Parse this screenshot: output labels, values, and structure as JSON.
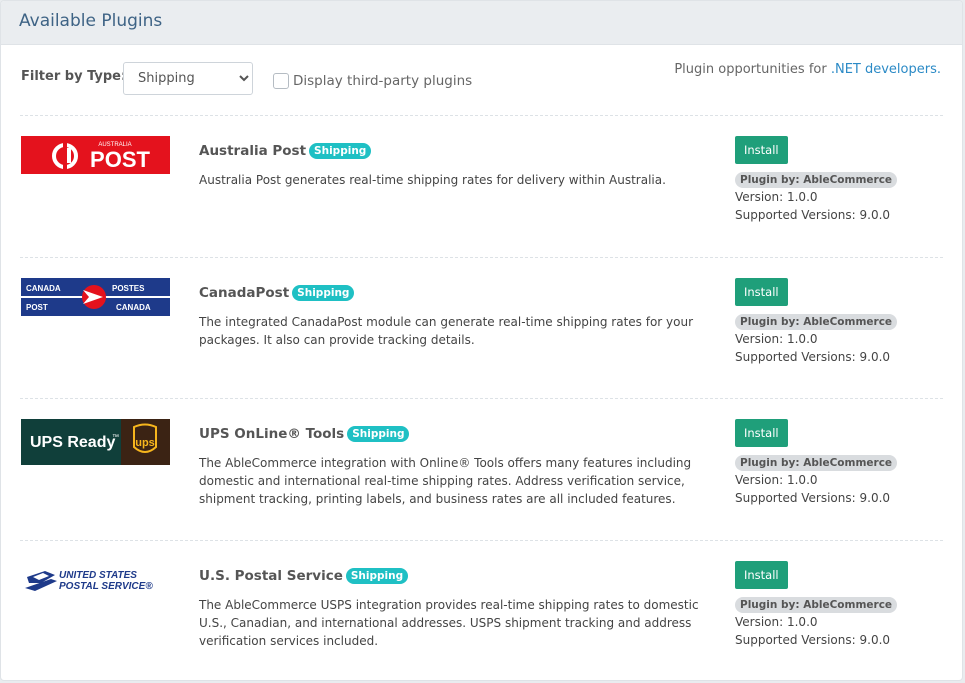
{
  "header": {
    "title": "Available Plugins"
  },
  "filter": {
    "label": "Filter by Type:",
    "selected": "Shipping",
    "third_party_label": "Display third-party plugins",
    "opportunities_prefix": "Plugin opportunities for ",
    "opportunities_link": ".NET developers."
  },
  "plugins": [
    {
      "name": "Australia Post",
      "type": "Shipping",
      "description": "Australia Post generates real-time shipping rates for delivery within Australia.",
      "install_label": "Install",
      "author": "Plugin by: AbleCommerce",
      "version": "Version: 1.0.0",
      "supported": "Supported Versions: 9.0.0",
      "logo_text": "POST",
      "logo_small": "AUSTRALIA"
    },
    {
      "name": "CanadaPost",
      "type": "Shipping",
      "description": "The integrated CanadaPost module can generate real-time shipping rates for your packages. It also can provide tracking details.",
      "install_label": "Install",
      "author": "Plugin by: AbleCommerce",
      "version": "Version: 1.0.0",
      "supported": "Supported Versions: 9.0.0",
      "logo_tl": "CANADA",
      "logo_tr": "POSTES",
      "logo_bl": "POST",
      "logo_br": "CANADA"
    },
    {
      "name": "UPS OnLine® Tools",
      "type": "Shipping",
      "description": "The AbleCommerce integration with Online® Tools offers many features including domestic and international real-time shipping rates. Address verification service, shipment tracking, printing labels, and business rates are all included features.",
      "install_label": "Install",
      "author": "Plugin by: AbleCommerce",
      "version": "Version: 1.0.0",
      "supported": "Supported Versions: 9.0.0",
      "logo_text": "UPS Ready",
      "logo_tm": "™",
      "logo_shield": "ups"
    },
    {
      "name": "U.S. Postal Service",
      "type": "Shipping",
      "description": "The AbleCommerce USPS integration provides real-time shipping rates to domestic U.S., Canadian, and international addresses. USPS shipment tracking and address verification services included.",
      "install_label": "Install",
      "author": "Plugin by: AbleCommerce",
      "version": "Version: 1.0.0",
      "supported": "Supported Versions: 9.0.0",
      "logo_line1": "UNITED STATES",
      "logo_line2": "POSTAL SERVICE®"
    }
  ],
  "colors": {
    "install": "#1f9f7a",
    "badge": "#1fc0c4",
    "link": "#2b8ac6",
    "ap_red": "#e4121d",
    "canada_blue": "#1e3a8a",
    "ups_brown": "#3b2314",
    "ups_gold": "#f6b51d"
  }
}
